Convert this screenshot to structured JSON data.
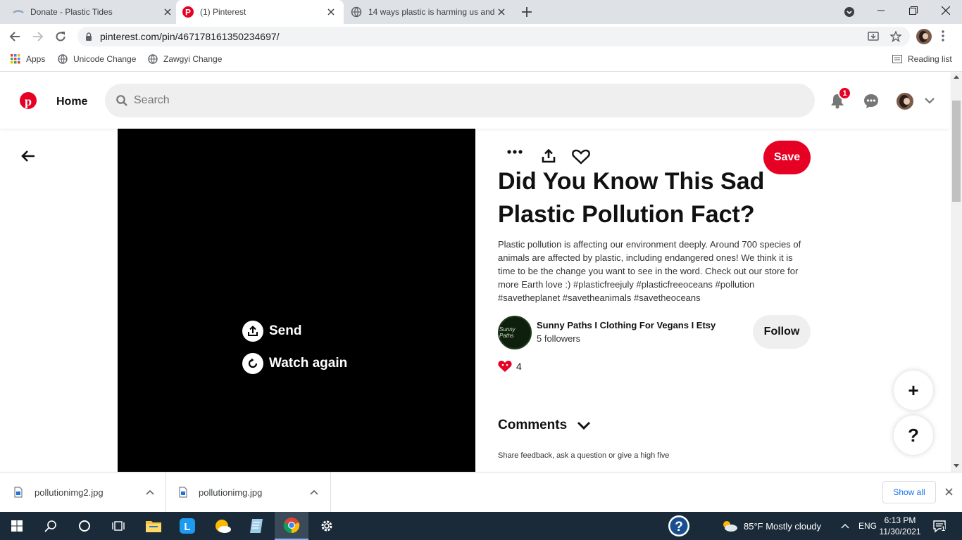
{
  "browser": {
    "tabs": [
      {
        "title": "Donate - Plastic Tides",
        "active": false
      },
      {
        "title": "(1) Pinterest",
        "active": true
      },
      {
        "title": "14 ways plastic is harming us and",
        "active": false
      }
    ],
    "url": "pinterest.com/pin/467178161350234697/",
    "bookmarks": [
      "Apps",
      "Unicode Change",
      "Zawgyi Change"
    ],
    "reading_list": "Reading list"
  },
  "pinterest": {
    "nav_home": "Home",
    "search_placeholder": "Search",
    "notification_count": "1",
    "pin": {
      "title": "Did You Know This Sad Plastic Pollution Fact?",
      "description": "Plastic pollution is affecting our environment deeply. Around 700 species of animals are affected by plastic, including endangered ones! We think it is time to be the change you want to see in the word. Check out our store for more Earth love :) #plasticfreejuly #plasticfreeoceans #pollution #savetheplanet #savetheanimals #savetheoceans",
      "save_label": "Save",
      "video_send": "Send",
      "video_watch_again": "Watch again",
      "profile_name": "Sunny Paths I Clothing For Vegans I Etsy",
      "profile_followers": "5 followers",
      "profile_avatar_text": "Sunny Paths",
      "follow_label": "Follow",
      "reaction_count": "4",
      "comments_label": "Comments",
      "comments_prompt": "Share feedback, ask a question or give a high five"
    },
    "fab_add": "+",
    "fab_help": "?"
  },
  "downloads": {
    "items": [
      "pollutionimg2.jpg",
      "pollutionimg.jpg"
    ],
    "show_all": "Show all"
  },
  "taskbar": {
    "weather": "85°F  Mostly cloudy",
    "language": "ENG",
    "time": "6:13 PM",
    "date": "11/30/2021",
    "notification_count": "1"
  },
  "colors": {
    "pinterest_red": "#e60023",
    "taskbar": "#1b2a38",
    "tabstrip": "#dee1e6"
  }
}
